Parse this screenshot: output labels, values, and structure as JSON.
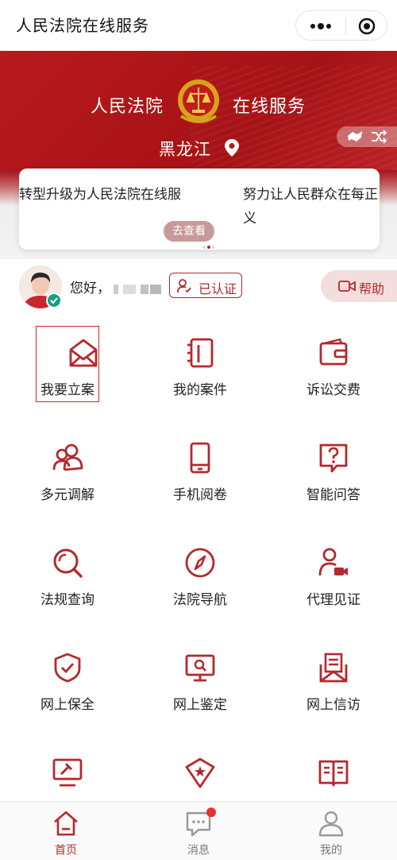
{
  "header": {
    "title": "人民法院在线服务"
  },
  "hero": {
    "brand_left": "人民法院",
    "brand_right": "在线服务",
    "region": "黑龙江"
  },
  "news": {
    "item1": "转型升级为人民法院在线服",
    "item2": "努力让人民群众在每正义",
    "button": "去查看"
  },
  "user": {
    "greeting": "您好，",
    "verified_label": "已认证",
    "help_label": "帮助"
  },
  "services": [
    {
      "label": "我要立案",
      "icon": "envelope-icon"
    },
    {
      "label": "我的案件",
      "icon": "case-folder-icon"
    },
    {
      "label": "诉讼交费",
      "icon": "wallet-icon"
    },
    {
      "label": "多元调解",
      "icon": "people-icon"
    },
    {
      "label": "手机阅卷",
      "icon": "phone-icon"
    },
    {
      "label": "智能问答",
      "icon": "question-icon"
    },
    {
      "label": "法规查询",
      "icon": "search-icon"
    },
    {
      "label": "法院导航",
      "icon": "compass-icon"
    },
    {
      "label": "代理见证",
      "icon": "video-person-icon"
    },
    {
      "label": "网上保全",
      "icon": "shield-icon"
    },
    {
      "label": "网上鉴定",
      "icon": "monitor-search-icon"
    },
    {
      "label": "网上信访",
      "icon": "letter-icon"
    },
    {
      "label": "",
      "icon": "gavel-screen-icon"
    },
    {
      "label": "",
      "icon": "star-badge-icon"
    },
    {
      "label": "",
      "icon": "book-icon"
    }
  ],
  "tabbar": {
    "home": "首页",
    "messages": "消息",
    "mine": "我的"
  },
  "colors": {
    "accent": "#b4282d",
    "hero": "#a8161a"
  }
}
